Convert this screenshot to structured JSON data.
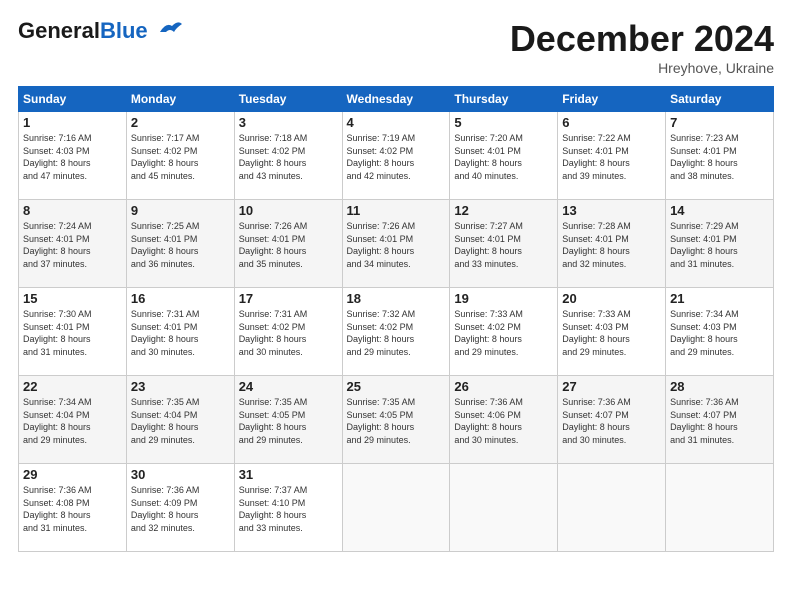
{
  "header": {
    "logo_general": "General",
    "logo_blue": "Blue",
    "month_title": "December 2024",
    "location": "Hreyhove, Ukraine"
  },
  "weekdays": [
    "Sunday",
    "Monday",
    "Tuesday",
    "Wednesday",
    "Thursday",
    "Friday",
    "Saturday"
  ],
  "weeks": [
    [
      {
        "day": 1,
        "info": "Sunrise: 7:16 AM\nSunset: 4:03 PM\nDaylight: 8 hours\nand 47 minutes."
      },
      {
        "day": 2,
        "info": "Sunrise: 7:17 AM\nSunset: 4:02 PM\nDaylight: 8 hours\nand 45 minutes."
      },
      {
        "day": 3,
        "info": "Sunrise: 7:18 AM\nSunset: 4:02 PM\nDaylight: 8 hours\nand 43 minutes."
      },
      {
        "day": 4,
        "info": "Sunrise: 7:19 AM\nSunset: 4:02 PM\nDaylight: 8 hours\nand 42 minutes."
      },
      {
        "day": 5,
        "info": "Sunrise: 7:20 AM\nSunset: 4:01 PM\nDaylight: 8 hours\nand 40 minutes."
      },
      {
        "day": 6,
        "info": "Sunrise: 7:22 AM\nSunset: 4:01 PM\nDaylight: 8 hours\nand 39 minutes."
      },
      {
        "day": 7,
        "info": "Sunrise: 7:23 AM\nSunset: 4:01 PM\nDaylight: 8 hours\nand 38 minutes."
      }
    ],
    [
      {
        "day": 8,
        "info": "Sunrise: 7:24 AM\nSunset: 4:01 PM\nDaylight: 8 hours\nand 37 minutes."
      },
      {
        "day": 9,
        "info": "Sunrise: 7:25 AM\nSunset: 4:01 PM\nDaylight: 8 hours\nand 36 minutes."
      },
      {
        "day": 10,
        "info": "Sunrise: 7:26 AM\nSunset: 4:01 PM\nDaylight: 8 hours\nand 35 minutes."
      },
      {
        "day": 11,
        "info": "Sunrise: 7:26 AM\nSunset: 4:01 PM\nDaylight: 8 hours\nand 34 minutes."
      },
      {
        "day": 12,
        "info": "Sunrise: 7:27 AM\nSunset: 4:01 PM\nDaylight: 8 hours\nand 33 minutes."
      },
      {
        "day": 13,
        "info": "Sunrise: 7:28 AM\nSunset: 4:01 PM\nDaylight: 8 hours\nand 32 minutes."
      },
      {
        "day": 14,
        "info": "Sunrise: 7:29 AM\nSunset: 4:01 PM\nDaylight: 8 hours\nand 31 minutes."
      }
    ],
    [
      {
        "day": 15,
        "info": "Sunrise: 7:30 AM\nSunset: 4:01 PM\nDaylight: 8 hours\nand 31 minutes."
      },
      {
        "day": 16,
        "info": "Sunrise: 7:31 AM\nSunset: 4:01 PM\nDaylight: 8 hours\nand 30 minutes."
      },
      {
        "day": 17,
        "info": "Sunrise: 7:31 AM\nSunset: 4:02 PM\nDaylight: 8 hours\nand 30 minutes."
      },
      {
        "day": 18,
        "info": "Sunrise: 7:32 AM\nSunset: 4:02 PM\nDaylight: 8 hours\nand 29 minutes."
      },
      {
        "day": 19,
        "info": "Sunrise: 7:33 AM\nSunset: 4:02 PM\nDaylight: 8 hours\nand 29 minutes."
      },
      {
        "day": 20,
        "info": "Sunrise: 7:33 AM\nSunset: 4:03 PM\nDaylight: 8 hours\nand 29 minutes."
      },
      {
        "day": 21,
        "info": "Sunrise: 7:34 AM\nSunset: 4:03 PM\nDaylight: 8 hours\nand 29 minutes."
      }
    ],
    [
      {
        "day": 22,
        "info": "Sunrise: 7:34 AM\nSunset: 4:04 PM\nDaylight: 8 hours\nand 29 minutes."
      },
      {
        "day": 23,
        "info": "Sunrise: 7:35 AM\nSunset: 4:04 PM\nDaylight: 8 hours\nand 29 minutes."
      },
      {
        "day": 24,
        "info": "Sunrise: 7:35 AM\nSunset: 4:05 PM\nDaylight: 8 hours\nand 29 minutes."
      },
      {
        "day": 25,
        "info": "Sunrise: 7:35 AM\nSunset: 4:05 PM\nDaylight: 8 hours\nand 29 minutes."
      },
      {
        "day": 26,
        "info": "Sunrise: 7:36 AM\nSunset: 4:06 PM\nDaylight: 8 hours\nand 30 minutes."
      },
      {
        "day": 27,
        "info": "Sunrise: 7:36 AM\nSunset: 4:07 PM\nDaylight: 8 hours\nand 30 minutes."
      },
      {
        "day": 28,
        "info": "Sunrise: 7:36 AM\nSunset: 4:07 PM\nDaylight: 8 hours\nand 31 minutes."
      }
    ],
    [
      {
        "day": 29,
        "info": "Sunrise: 7:36 AM\nSunset: 4:08 PM\nDaylight: 8 hours\nand 31 minutes."
      },
      {
        "day": 30,
        "info": "Sunrise: 7:36 AM\nSunset: 4:09 PM\nDaylight: 8 hours\nand 32 minutes."
      },
      {
        "day": 31,
        "info": "Sunrise: 7:37 AM\nSunset: 4:10 PM\nDaylight: 8 hours\nand 33 minutes."
      },
      null,
      null,
      null,
      null
    ]
  ]
}
